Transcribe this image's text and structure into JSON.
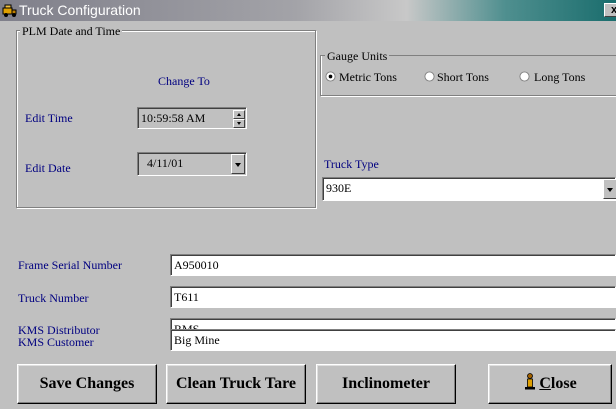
{
  "window": {
    "title": "Truck Configuration",
    "close_glyph": "x",
    "icon": "truck-icon"
  },
  "plm": {
    "legend": "PLM Date and Time",
    "change_to": "Change To",
    "edit_time_label": "Edit Time",
    "edit_time_value": "10:59:58 AM",
    "edit_date_label": "Edit Date",
    "edit_date_value": "4/11/01"
  },
  "gauge": {
    "legend": "Gauge Units",
    "options": [
      "Metric Tons",
      "Short Tons",
      "Long Tons"
    ],
    "selected": "Metric Tons"
  },
  "truck_type": {
    "label": "Truck Type",
    "value": "930E"
  },
  "fields": {
    "frame_serial_label": "Frame Serial Number",
    "frame_serial_value": "A950010",
    "truck_number_label": "Truck Number",
    "truck_number_value": "T611",
    "distributor_label": "KMS Distributor",
    "distributor_value": "RMS",
    "customer_label": "KMS Customer",
    "customer_value": "Big Mine"
  },
  "buttons": {
    "save": "Save Changes",
    "clean": "Clean Truck Tare",
    "inclinometer": "Inclinometer",
    "close_accel": "C",
    "close_rest": "lose",
    "close_icon": "person-icon"
  }
}
